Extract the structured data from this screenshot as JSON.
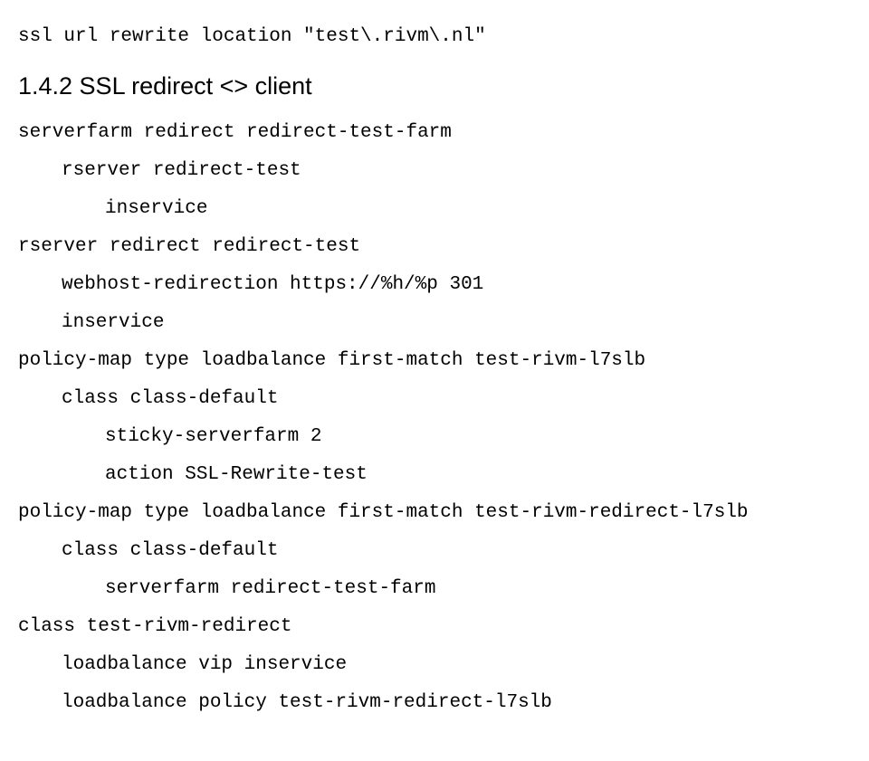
{
  "first_line": "ssl url rewrite location \"test\\.rivm\\.nl\"",
  "heading": "1.4.2   SSL redirect <> client",
  "lines": {
    "l1": "serverfarm redirect redirect-test-farm",
    "l2": "rserver redirect-test",
    "l3": "inservice",
    "l4": "rserver redirect redirect-test",
    "l5": "webhost-redirection https://%h/%p 301",
    "l6": "inservice",
    "l7": "policy-map type loadbalance first-match test-rivm-l7slb",
    "l8": "class class-default",
    "l9": "sticky-serverfarm 2",
    "l10": "action SSL-Rewrite-test",
    "l11": "policy-map type loadbalance first-match test-rivm-redirect-l7slb",
    "l12": "class class-default",
    "l13": "serverfarm redirect-test-farm",
    "l14": "class test-rivm-redirect",
    "l15": "loadbalance vip inservice",
    "l16": "loadbalance policy test-rivm-redirect-l7slb"
  }
}
